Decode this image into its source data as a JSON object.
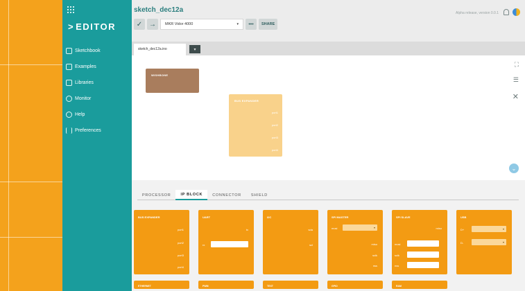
{
  "app": {
    "logo": "EDITOR",
    "logo_chevron": ">"
  },
  "sidebar": {
    "items": [
      {
        "label": "Sketchbook",
        "icon": "folder-icon"
      },
      {
        "label": "Examples",
        "icon": "examples-icon"
      },
      {
        "label": "Libraries",
        "icon": "libraries-icon"
      },
      {
        "label": "Monitor",
        "icon": "monitor-icon"
      },
      {
        "label": "Help",
        "icon": "help-icon"
      },
      {
        "label": "Preferences",
        "icon": "preferences-icon"
      }
    ]
  },
  "header": {
    "sketch_name": "sketch_dec12a",
    "release": "Alpha release, version 0.0.1",
    "verify_icon": "✓",
    "upload_icon": "→",
    "board": "MKR Vidor 4000",
    "board_caret": "▾",
    "more_label": "•••",
    "share_label": "SHARE"
  },
  "tabs": {
    "file": "sketch_dec12a.ino",
    "menu_icon": "▾"
  },
  "canvas": {
    "fit_icon": "⛶",
    "indent_icon": "☰",
    "close_icon": "✕",
    "scroll_icon": "⌄",
    "blocks": [
      {
        "title": "WISHBONE",
        "ports": [],
        "color": "#a97d5d"
      },
      {
        "title": "BUS EXPANDER",
        "ports": [
          "port1",
          "port2",
          "port3",
          "port4"
        ],
        "color": "#f9d28b"
      }
    ]
  },
  "panel": {
    "tabs": [
      "PROCESSOR",
      "IP BLOCK",
      "CONNECTOR",
      "SHIELD"
    ],
    "active_tab": "IP BLOCK",
    "blocks": [
      {
        "title": "BUS EXPANDER",
        "rows": [
          "port1",
          "port2",
          "port3",
          "port4"
        ]
      },
      {
        "title": "UART",
        "rows": [
          "tx",
          "rx"
        ]
      },
      {
        "title": "I2C",
        "rows": [
          "sda",
          "scl"
        ]
      },
      {
        "title": "SPI MASTER",
        "rows": [
          "mosi",
          "miso",
          "sclk",
          "nss"
        ]
      },
      {
        "title": "SPI SLAVE",
        "rows": [
          "miso",
          "mosi",
          "sclk",
          "nss"
        ]
      },
      {
        "title": "USB",
        "rows": [
          "D+",
          "D-"
        ]
      }
    ],
    "second_row": [
      "ETHERNET",
      "PWM",
      "TEXT",
      "GPIO",
      "RAM"
    ]
  },
  "colors": {
    "sidebar": "#1a9c9c",
    "accent": "#f39b13",
    "backdrop": "#f4a21c"
  }
}
